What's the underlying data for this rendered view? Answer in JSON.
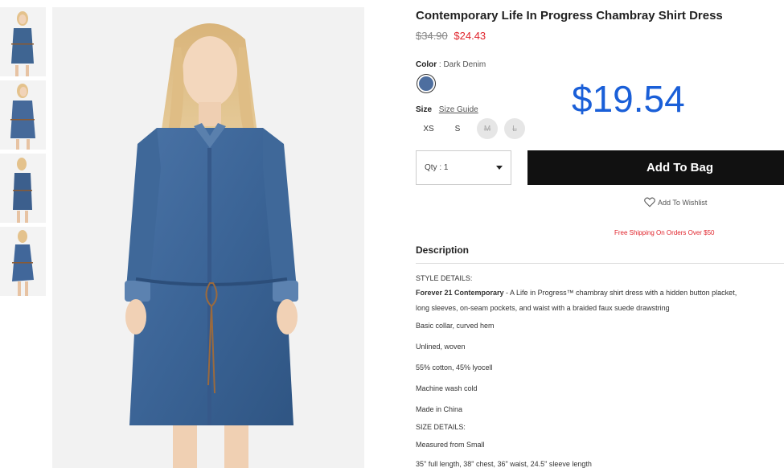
{
  "gallery": {
    "thumbnails": [
      "thumb-1",
      "thumb-2",
      "thumb-3",
      "thumb-4"
    ],
    "main_image": "woman-in-denim-shirt-dress"
  },
  "product": {
    "title": "Contemporary Life In Progress Chambray Shirt Dress",
    "price_original": "$34.90",
    "price_sale": "$24.43",
    "overlay_price": "$19.54",
    "color_label": "Color",
    "color_separator": ":",
    "color_value": "Dark Denim",
    "swatch_color": "#4d6e9f",
    "size_label": "Size",
    "size_guide": "Size Guide",
    "sizes": [
      {
        "label": "XS",
        "available": true
      },
      {
        "label": "S",
        "available": true
      },
      {
        "label": "M",
        "available": false
      },
      {
        "label": "L",
        "available": false
      }
    ],
    "qty_label": "Qty : 1",
    "add_to_bag": "Add To Bag",
    "wishlist": "Add To Wishlist",
    "free_shipping": "Free Shipping On Orders Over $50"
  },
  "description": {
    "heading": "Description",
    "style_details_heading": "STYLE DETAILS:",
    "brand_bold": "Forever 21 Contemporary",
    "summary_line1": " - A Life in Progress™ chambray shirt dress with a hidden button placket,",
    "summary_line2": "long sleeves, on-seam pockets, and waist with a braided faux suede drawstring",
    "bullets": [
      "Basic collar, curved hem",
      "Unlined, woven",
      "55% cotton, 45% lyocell",
      "Machine wash cold",
      "Made in China"
    ],
    "size_details_heading": "SIZE DETAILS:",
    "measured": "Measured from Small",
    "measurements": "35\" full length, 38\" chest, 36\" waist, 24.5\" sleeve length"
  },
  "colors": {
    "sale_red": "#e0232b",
    "overlay_blue": "#1a5fd8",
    "button_black": "#111111"
  }
}
